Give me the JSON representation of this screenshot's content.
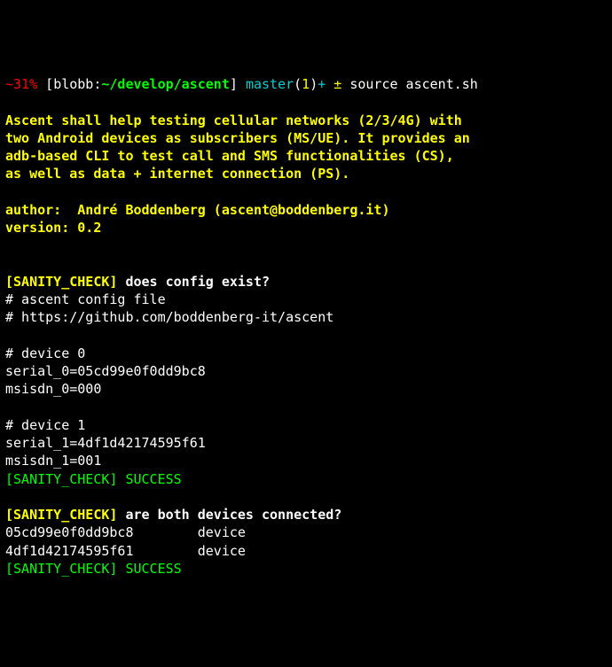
{
  "prompt": {
    "tilde": "~",
    "percent": "31%",
    "lbracket": " [",
    "user": "blobb",
    "colon": ":",
    "path": "~/develop/ascent",
    "rbracket": "] ",
    "branch": "master",
    "lparen": "(",
    "count": "1",
    "rparen": ")",
    "plus": "+ ",
    "pm": "±",
    "cmd": " source ascent.sh"
  },
  "blank": "",
  "desc1": "Ascent shall help testing cellular networks (2/3/4G) with",
  "desc2": "two Android devices as subscribers (MS/UE). It provides an",
  "desc3": "adb-based CLI to test call and SMS functionalities (CS),",
  "desc4": "as well as data + internet connection (PS).",
  "author": "author:  André Boddenberg (ascent@boddenberg.it)",
  "version": "version: 0.2",
  "sanity1_label": "[SANITY_CHECK]",
  "sanity1_text": " does config exist?",
  "cfg1": "# ascent config file",
  "cfg2": "# https://github.com/boddenberg-it/ascent",
  "dev0_header": "# device 0",
  "dev0_serial": "serial_0=05cd99e0f0dd9bc8",
  "dev0_msisdn": "msisdn_0=000",
  "dev1_header": "# device 1",
  "dev1_serial": "serial_1=4df1d42174595f61",
  "dev1_msisdn": "msisdn_1=001",
  "success1_label": "[SANITY_CHECK]",
  "success1_text": " SUCCESS",
  "sanity2_label": "[SANITY_CHECK]",
  "sanity2_text": " are both devices connected?",
  "device_row0": "05cd99e0f0dd9bc8        device",
  "device_row1": "4df1d42174595f61        device",
  "success2_label": "[SANITY_CHECK]",
  "success2_text": " SUCCESS"
}
